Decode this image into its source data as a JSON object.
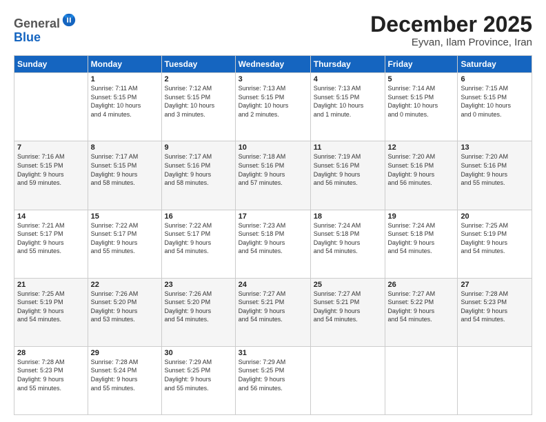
{
  "logo": {
    "general": "General",
    "blue": "Blue"
  },
  "header": {
    "title": "December 2025",
    "subtitle": "Eyvan, Ilam Province, Iran"
  },
  "weekdays": [
    "Sunday",
    "Monday",
    "Tuesday",
    "Wednesday",
    "Thursday",
    "Friday",
    "Saturday"
  ],
  "weeks": [
    [
      {
        "day": "",
        "info": ""
      },
      {
        "day": "1",
        "info": "Sunrise: 7:11 AM\nSunset: 5:15 PM\nDaylight: 10 hours\nand 4 minutes."
      },
      {
        "day": "2",
        "info": "Sunrise: 7:12 AM\nSunset: 5:15 PM\nDaylight: 10 hours\nand 3 minutes."
      },
      {
        "day": "3",
        "info": "Sunrise: 7:13 AM\nSunset: 5:15 PM\nDaylight: 10 hours\nand 2 minutes."
      },
      {
        "day": "4",
        "info": "Sunrise: 7:13 AM\nSunset: 5:15 PM\nDaylight: 10 hours\nand 1 minute."
      },
      {
        "day": "5",
        "info": "Sunrise: 7:14 AM\nSunset: 5:15 PM\nDaylight: 10 hours\nand 0 minutes."
      },
      {
        "day": "6",
        "info": "Sunrise: 7:15 AM\nSunset: 5:15 PM\nDaylight: 10 hours\nand 0 minutes."
      }
    ],
    [
      {
        "day": "7",
        "info": "Sunrise: 7:16 AM\nSunset: 5:15 PM\nDaylight: 9 hours\nand 59 minutes."
      },
      {
        "day": "8",
        "info": "Sunrise: 7:17 AM\nSunset: 5:15 PM\nDaylight: 9 hours\nand 58 minutes."
      },
      {
        "day": "9",
        "info": "Sunrise: 7:17 AM\nSunset: 5:16 PM\nDaylight: 9 hours\nand 58 minutes."
      },
      {
        "day": "10",
        "info": "Sunrise: 7:18 AM\nSunset: 5:16 PM\nDaylight: 9 hours\nand 57 minutes."
      },
      {
        "day": "11",
        "info": "Sunrise: 7:19 AM\nSunset: 5:16 PM\nDaylight: 9 hours\nand 56 minutes."
      },
      {
        "day": "12",
        "info": "Sunrise: 7:20 AM\nSunset: 5:16 PM\nDaylight: 9 hours\nand 56 minutes."
      },
      {
        "day": "13",
        "info": "Sunrise: 7:20 AM\nSunset: 5:16 PM\nDaylight: 9 hours\nand 55 minutes."
      }
    ],
    [
      {
        "day": "14",
        "info": "Sunrise: 7:21 AM\nSunset: 5:17 PM\nDaylight: 9 hours\nand 55 minutes."
      },
      {
        "day": "15",
        "info": "Sunrise: 7:22 AM\nSunset: 5:17 PM\nDaylight: 9 hours\nand 55 minutes."
      },
      {
        "day": "16",
        "info": "Sunrise: 7:22 AM\nSunset: 5:17 PM\nDaylight: 9 hours\nand 54 minutes."
      },
      {
        "day": "17",
        "info": "Sunrise: 7:23 AM\nSunset: 5:18 PM\nDaylight: 9 hours\nand 54 minutes."
      },
      {
        "day": "18",
        "info": "Sunrise: 7:24 AM\nSunset: 5:18 PM\nDaylight: 9 hours\nand 54 minutes."
      },
      {
        "day": "19",
        "info": "Sunrise: 7:24 AM\nSunset: 5:18 PM\nDaylight: 9 hours\nand 54 minutes."
      },
      {
        "day": "20",
        "info": "Sunrise: 7:25 AM\nSunset: 5:19 PM\nDaylight: 9 hours\nand 54 minutes."
      }
    ],
    [
      {
        "day": "21",
        "info": "Sunrise: 7:25 AM\nSunset: 5:19 PM\nDaylight: 9 hours\nand 54 minutes."
      },
      {
        "day": "22",
        "info": "Sunrise: 7:26 AM\nSunset: 5:20 PM\nDaylight: 9 hours\nand 53 minutes."
      },
      {
        "day": "23",
        "info": "Sunrise: 7:26 AM\nSunset: 5:20 PM\nDaylight: 9 hours\nand 54 minutes."
      },
      {
        "day": "24",
        "info": "Sunrise: 7:27 AM\nSunset: 5:21 PM\nDaylight: 9 hours\nand 54 minutes."
      },
      {
        "day": "25",
        "info": "Sunrise: 7:27 AM\nSunset: 5:21 PM\nDaylight: 9 hours\nand 54 minutes."
      },
      {
        "day": "26",
        "info": "Sunrise: 7:27 AM\nSunset: 5:22 PM\nDaylight: 9 hours\nand 54 minutes."
      },
      {
        "day": "27",
        "info": "Sunrise: 7:28 AM\nSunset: 5:23 PM\nDaylight: 9 hours\nand 54 minutes."
      }
    ],
    [
      {
        "day": "28",
        "info": "Sunrise: 7:28 AM\nSunset: 5:23 PM\nDaylight: 9 hours\nand 55 minutes."
      },
      {
        "day": "29",
        "info": "Sunrise: 7:28 AM\nSunset: 5:24 PM\nDaylight: 9 hours\nand 55 minutes."
      },
      {
        "day": "30",
        "info": "Sunrise: 7:29 AM\nSunset: 5:25 PM\nDaylight: 9 hours\nand 55 minutes."
      },
      {
        "day": "31",
        "info": "Sunrise: 7:29 AM\nSunset: 5:25 PM\nDaylight: 9 hours\nand 56 minutes."
      },
      {
        "day": "",
        "info": ""
      },
      {
        "day": "",
        "info": ""
      },
      {
        "day": "",
        "info": ""
      }
    ]
  ]
}
